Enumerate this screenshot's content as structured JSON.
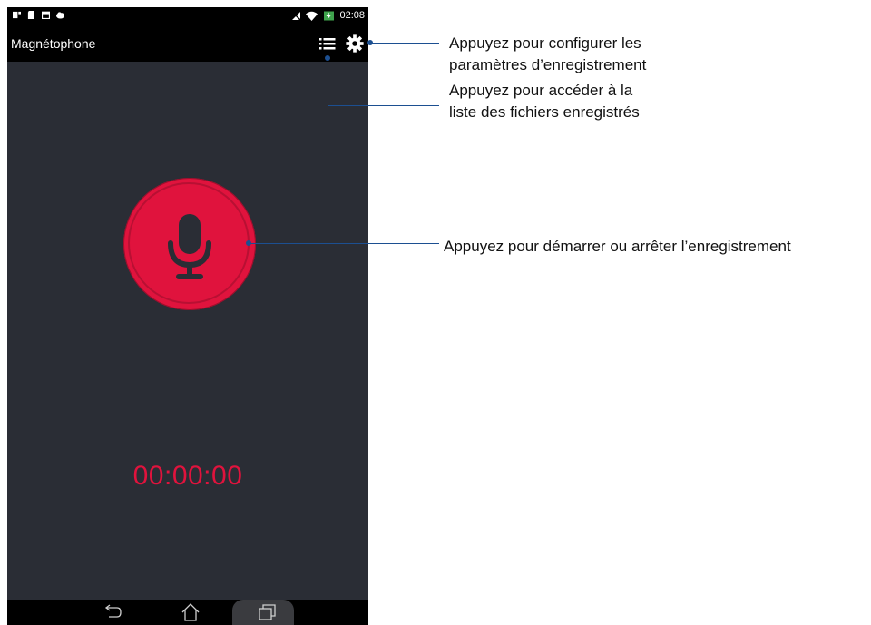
{
  "status_bar": {
    "time": "02:08",
    "left_icons": [
      "notification-icon",
      "sd-card-icon",
      "calendar-icon",
      "cloud-icon"
    ],
    "right_icons": [
      "no-signal-icon",
      "wifi-icon",
      "battery-charging-icon"
    ]
  },
  "app_bar": {
    "title": "Magnétophone",
    "icons": [
      "list-icon",
      "gear-icon"
    ]
  },
  "recorder": {
    "timer": "00:00:00",
    "record_button_icon": "microphone-icon",
    "accent_color": "#e0133d"
  },
  "nav_bar": {
    "icons": [
      "back-icon",
      "home-icon",
      "recent-apps-icon"
    ]
  },
  "callouts": {
    "settings": [
      "Appuyez pour configurer les",
      "paramètres d’enregistrement"
    ],
    "list": [
      "Appuyez pour accéder à la",
      "liste des fichiers enregistrés"
    ],
    "record": "Appuyez pour démarrer ou arrêter l’enregistrement"
  }
}
